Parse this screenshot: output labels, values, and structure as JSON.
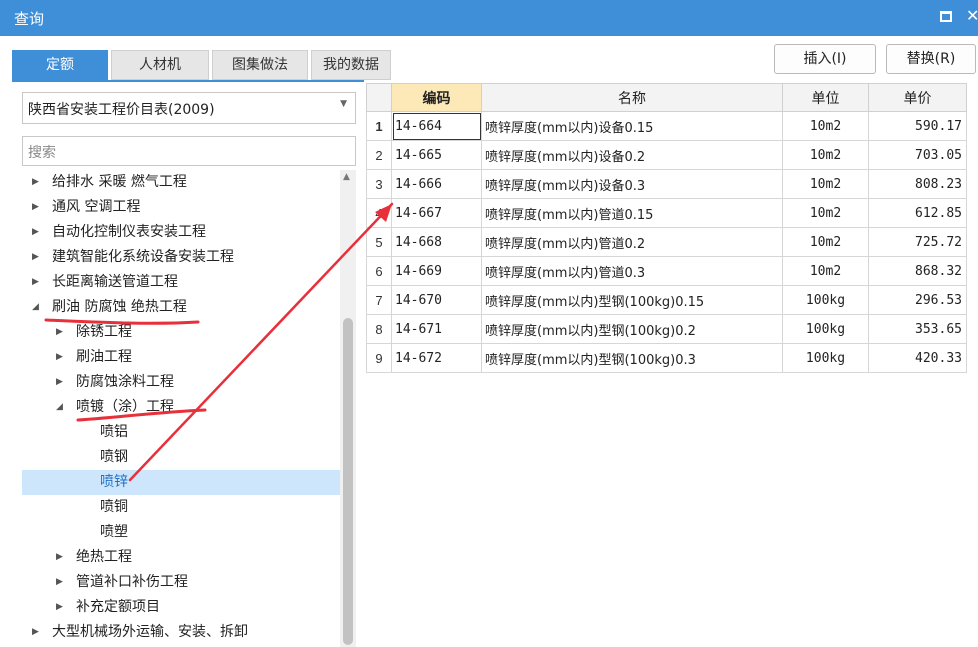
{
  "window": {
    "title": "查询"
  },
  "tabs": [
    {
      "label": "定额",
      "active": true
    },
    {
      "label": "人材机",
      "active": false
    },
    {
      "label": "图集做法",
      "active": false
    },
    {
      "label": "我的数据",
      "active": false
    }
  ],
  "buttons": {
    "insert": "插入(I)",
    "replace": "替换(R)"
  },
  "library_select": {
    "value": "陕西省安装工程价目表(2009)"
  },
  "search": {
    "placeholder": "搜索"
  },
  "tree": [
    {
      "label": "给排水 采暖 燃气工程",
      "level": 0,
      "state": "collapsed"
    },
    {
      "label": "通风 空调工程",
      "level": 0,
      "state": "collapsed"
    },
    {
      "label": "自动化控制仪表安装工程",
      "level": 0,
      "state": "collapsed"
    },
    {
      "label": "建筑智能化系统设备安装工程",
      "level": 0,
      "state": "collapsed"
    },
    {
      "label": "长距离输送管道工程",
      "level": 0,
      "state": "collapsed"
    },
    {
      "label": "刷油 防腐蚀 绝热工程",
      "level": 0,
      "state": "expanded"
    },
    {
      "label": "除锈工程",
      "level": 1,
      "state": "collapsed"
    },
    {
      "label": "刷油工程",
      "level": 1,
      "state": "collapsed"
    },
    {
      "label": "防腐蚀涂料工程",
      "level": 1,
      "state": "collapsed"
    },
    {
      "label": "喷镀（涂）工程",
      "level": 1,
      "state": "expanded"
    },
    {
      "label": "喷铝",
      "level": 2,
      "state": "leaf"
    },
    {
      "label": "喷钢",
      "level": 2,
      "state": "leaf"
    },
    {
      "label": "喷锌",
      "level": 2,
      "state": "leaf",
      "selected": true
    },
    {
      "label": "喷铜",
      "level": 2,
      "state": "leaf"
    },
    {
      "label": "喷塑",
      "level": 2,
      "state": "leaf"
    },
    {
      "label": "绝热工程",
      "level": 1,
      "state": "collapsed"
    },
    {
      "label": "管道补口补伤工程",
      "level": 1,
      "state": "collapsed"
    },
    {
      "label": "补充定额项目",
      "level": 1,
      "state": "collapsed"
    },
    {
      "label": "大型机械场外运输、安装、拆卸",
      "level": 0,
      "state": "collapsed"
    }
  ],
  "table": {
    "headers": {
      "code": "编码",
      "name": "名称",
      "unit": "单位",
      "price": "单价"
    },
    "rows": [
      {
        "num": "1",
        "code": "14-664",
        "name": "喷锌厚度(mm以内)设备0.15",
        "unit": "10m2",
        "price": "590.17"
      },
      {
        "num": "2",
        "code": "14-665",
        "name": "喷锌厚度(mm以内)设备0.2",
        "unit": "10m2",
        "price": "703.05"
      },
      {
        "num": "3",
        "code": "14-666",
        "name": "喷锌厚度(mm以内)设备0.3",
        "unit": "10m2",
        "price": "808.23"
      },
      {
        "num": "4",
        "code": "14-667",
        "name": "喷锌厚度(mm以内)管道0.15",
        "unit": "10m2",
        "price": "612.85"
      },
      {
        "num": "5",
        "code": "14-668",
        "name": "喷锌厚度(mm以内)管道0.2",
        "unit": "10m2",
        "price": "725.72"
      },
      {
        "num": "6",
        "code": "14-669",
        "name": "喷锌厚度(mm以内)管道0.3",
        "unit": "10m2",
        "price": "868.32"
      },
      {
        "num": "7",
        "code": "14-670",
        "name": "喷锌厚度(mm以内)型钢(100kg)0.15",
        "unit": "100kg",
        "price": "296.53"
      },
      {
        "num": "8",
        "code": "14-671",
        "name": "喷锌厚度(mm以内)型钢(100kg)0.2",
        "unit": "100kg",
        "price": "353.65"
      },
      {
        "num": "9",
        "code": "14-672",
        "name": "喷锌厚度(mm以内)型钢(100kg)0.3",
        "unit": "100kg",
        "price": "420.33"
      }
    ]
  },
  "colors": {
    "accent": "#3f8ed8",
    "annotation": "#e8303a",
    "header_highlight": "#fde9b8",
    "selection": "#cde6fb"
  }
}
